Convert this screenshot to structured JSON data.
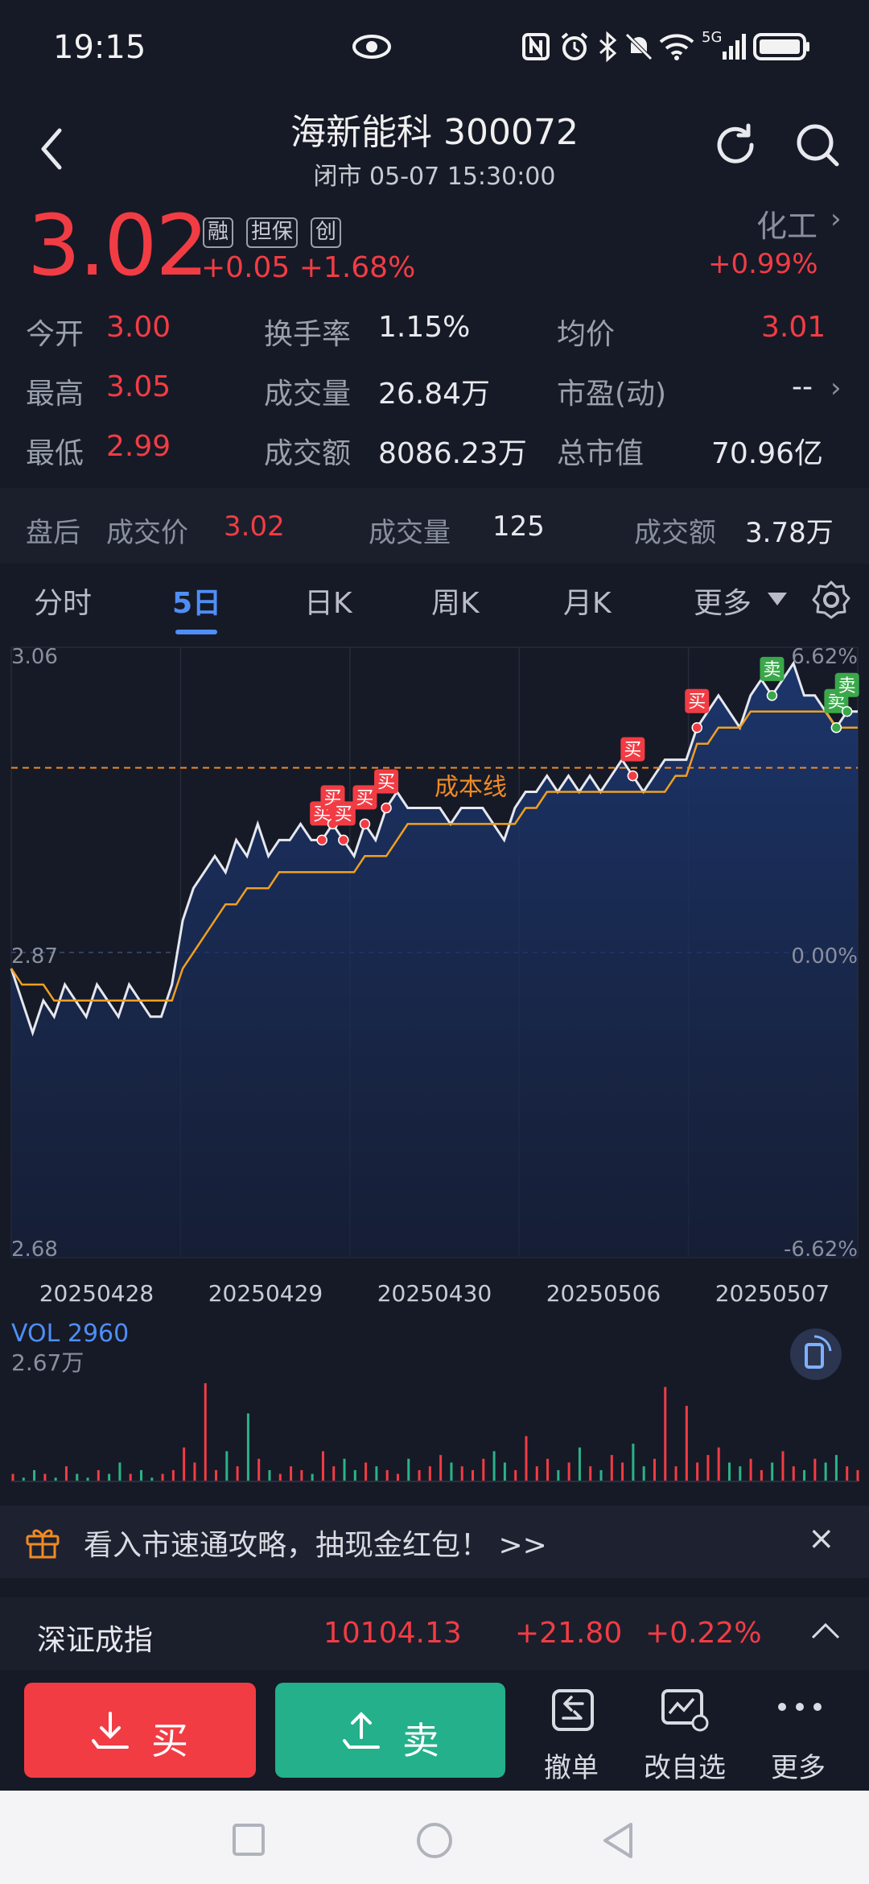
{
  "status": {
    "time": "19:15",
    "network": "5G"
  },
  "header": {
    "title": "海新能科 300072",
    "subtitle": "闭市 05-07 15:30:00"
  },
  "quote": {
    "price": "3.02",
    "tags": [
      "融",
      "担保",
      "创"
    ],
    "change": "+0.05  +1.68%",
    "industry": "化工",
    "industry_change": "+0.99%"
  },
  "stats": [
    {
      "label": "今开",
      "value": "3.00",
      "color": "red"
    },
    {
      "label": "换手率",
      "value": "1.15%",
      "color": "white"
    },
    {
      "label": "均价",
      "value": "3.01",
      "color": "red"
    },
    {
      "label": "最高",
      "value": "3.05",
      "color": "red"
    },
    {
      "label": "成交量",
      "value": "26.84万",
      "color": "white"
    },
    {
      "label": "市盈(动)",
      "value": "--",
      "color": "white"
    },
    {
      "label": "最低",
      "value": "2.99",
      "color": "red"
    },
    {
      "label": "成交额",
      "value": "8086.23万",
      "color": "white"
    },
    {
      "label": "总市值",
      "value": "70.96亿",
      "color": "white"
    }
  ],
  "after_hours": {
    "label": "盘后",
    "price_label": "成交价",
    "price": "3.02",
    "vol_label": "成交量",
    "vol": "125",
    "amt_label": "成交额",
    "amt": "3.78万"
  },
  "tabs": [
    "分时",
    "5日",
    "日K",
    "周K",
    "月K",
    "更多"
  ],
  "active_tab": "5日",
  "chart_data": {
    "type": "line",
    "y_labels_left": [
      "3.06",
      "2.87",
      "2.68"
    ],
    "y_labels_right": [
      "6.62%",
      "0.00%",
      "-6.62%"
    ],
    "ylim": [
      2.68,
      3.06
    ],
    "x_labels": [
      "20250428",
      "20250429",
      "20250430",
      "20250506",
      "20250507"
    ],
    "cost_line": {
      "label": "成本线",
      "value": 2.985
    },
    "series": [
      {
        "values": [
          2.86,
          2.84,
          2.82,
          2.84,
          2.83,
          2.85,
          2.84,
          2.83,
          2.85,
          2.84,
          2.83,
          2.85,
          2.84,
          2.83,
          2.83,
          2.85,
          2.89,
          2.91,
          2.92,
          2.93,
          2.92,
          2.94,
          2.93,
          2.95,
          2.93,
          2.94,
          2.94,
          2.95,
          2.94,
          2.94,
          2.95,
          2.94,
          2.93,
          2.95,
          2.94,
          2.96,
          2.97,
          2.96,
          2.96,
          2.96,
          2.96,
          2.95,
          2.96,
          2.96,
          2.96,
          2.95,
          2.94,
          2.96,
          2.97,
          2.97,
          2.98,
          2.97,
          2.98,
          2.97,
          2.98,
          2.97,
          2.98,
          2.99,
          2.98,
          2.97,
          2.98,
          2.99,
          2.99,
          2.99,
          3.01,
          3.02,
          3.03,
          3.02,
          3.01,
          3.03,
          3.04,
          3.03,
          3.04,
          3.05,
          3.03,
          3.03,
          3.02,
          3.01,
          3.02,
          3.02
        ]
      },
      {
        "name": "均价",
        "values": [
          2.86,
          2.85,
          2.85,
          2.85,
          2.84,
          2.84,
          2.84,
          2.84,
          2.84,
          2.84,
          2.84,
          2.84,
          2.84,
          2.84,
          2.84,
          2.84,
          2.86,
          2.87,
          2.88,
          2.89,
          2.9,
          2.9,
          2.91,
          2.91,
          2.91,
          2.92,
          2.92,
          2.92,
          2.92,
          2.92,
          2.92,
          2.92,
          2.92,
          2.93,
          2.93,
          2.93,
          2.94,
          2.95,
          2.95,
          2.95,
          2.95,
          2.95,
          2.95,
          2.95,
          2.95,
          2.95,
          2.95,
          2.95,
          2.96,
          2.96,
          2.97,
          2.97,
          2.97,
          2.97,
          2.97,
          2.97,
          2.97,
          2.97,
          2.97,
          2.97,
          2.97,
          2.97,
          2.98,
          2.98,
          3.0,
          3.0,
          3.01,
          3.01,
          3.01,
          3.02,
          3.02,
          3.02,
          3.02,
          3.02,
          3.02,
          3.02,
          3.02,
          3.01,
          3.01,
          3.01
        ]
      }
    ],
    "markers": [
      {
        "label": "买",
        "index": 29
      },
      {
        "label": "买",
        "index": 30
      },
      {
        "label": "买",
        "index": 31
      },
      {
        "label": "买",
        "index": 33
      },
      {
        "label": "买",
        "index": 35
      },
      {
        "label": "买",
        "index": 58
      },
      {
        "label": "买",
        "index": 64
      },
      {
        "label": "卖",
        "index": 71
      },
      {
        "label": "卖",
        "index": 77
      },
      {
        "label": "卖",
        "index": 78
      }
    ],
    "vol_label": "VOL 2960",
    "vol_max_label": "2.67万",
    "volume": [
      2,
      1,
      3,
      2,
      1,
      4,
      2,
      1,
      3,
      2,
      5,
      2,
      3,
      1,
      2,
      3,
      9,
      5,
      26,
      3,
      8,
      4,
      18,
      6,
      3,
      2,
      4,
      3,
      2,
      8,
      4,
      6,
      3,
      5,
      4,
      3,
      2,
      6,
      3,
      4,
      7,
      5,
      4,
      3,
      6,
      8,
      5,
      3,
      12,
      4,
      6,
      3,
      5,
      9,
      4,
      3,
      7,
      5,
      10,
      4,
      6,
      25,
      4,
      20,
      5,
      7,
      9,
      5,
      4,
      6,
      3,
      5,
      8,
      4,
      3,
      6,
      5,
      7,
      4,
      3
    ]
  },
  "banner": {
    "text": "看入市速通攻略，抽现金红包！ >>",
    "close": "×"
  },
  "index_bar": {
    "name": "深证成指",
    "value": "10104.13",
    "change": "+21.80",
    "pct": "+0.22%"
  },
  "actions": {
    "buy": "买",
    "sell": "卖",
    "cancel": "撤单",
    "watchlist": "改自选",
    "more": "更多"
  },
  "colors": {
    "red": "#f23c44",
    "green": "#23b08a",
    "accent": "#4f8ef7",
    "avg_line": "#f0a020"
  }
}
